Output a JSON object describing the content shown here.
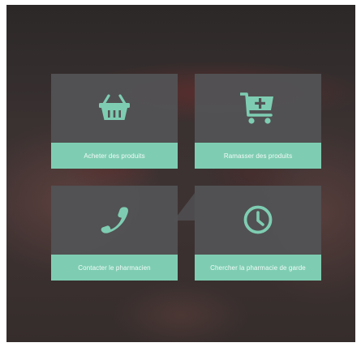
{
  "colors": {
    "tile_background": "#525254",
    "accent": "#7ecdb2",
    "label_text": "#f3fbf8"
  },
  "tiles": [
    {
      "label": "Acheter des produits",
      "icon": "shopping-basket-icon"
    },
    {
      "label": "Ramasser des produits",
      "icon": "cart-plus-icon"
    },
    {
      "label": "Contacter le pharmacien",
      "icon": "phone-icon"
    },
    {
      "label": "Chercher la pharmacie de garde",
      "icon": "clock-icon"
    }
  ]
}
